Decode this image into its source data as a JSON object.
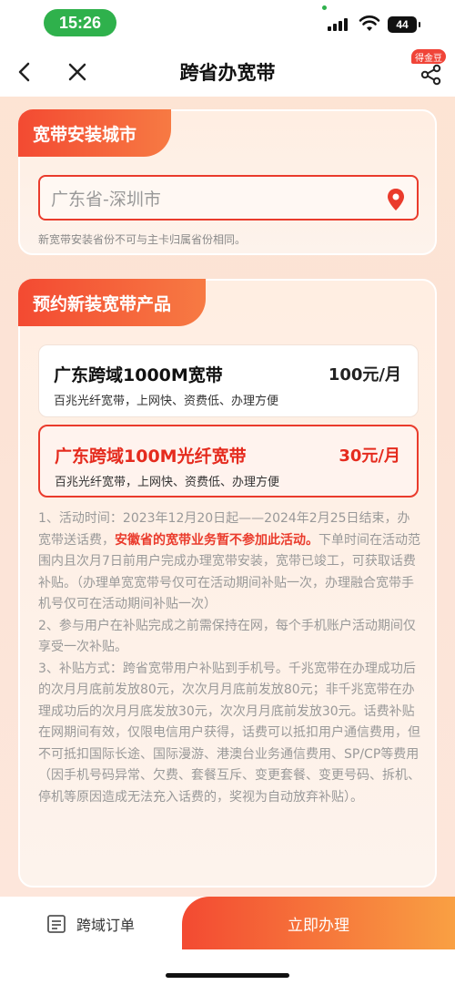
{
  "status_bar": {
    "time": "15:26",
    "battery": "44"
  },
  "nav": {
    "title": "跨省办宽带",
    "coin_badge": "得金豆",
    "icons": {
      "back": "back-arrow-icon",
      "close": "close-icon",
      "share": "share-icon"
    }
  },
  "city_section": {
    "heading": "宽带安装城市",
    "input_value": "广东省-深圳市",
    "note": "新宽带安装省份不可与主卡归属省份相同。",
    "icon": "location-pin-icon"
  },
  "product_section": {
    "heading": "预约新装宽带产品",
    "products": [
      {
        "name": "广东跨域1000M宽带",
        "price": "100元/月",
        "desc": "百兆光纤宽带，上网快、资费低、办理方便",
        "selected": false
      },
      {
        "name": "广东跨域100M光纤宽带",
        "price": "30元/月",
        "desc": "百兆光纤宽带，上网快、资费低、办理方便",
        "selected": true
      }
    ],
    "rules": {
      "p1_before": "1、活动时间：2023年12月20日起——2024年2月25日结束，办宽带送话费，",
      "p1_highlight": "安徽省的宽带业务暂不参加此活动。",
      "p1_after": "下单时间在活动范围内且次月7日前用户完成办理宽带安装，宽带已竣工，可获取话费补贴。（办理单宽宽带号仅可在活动期间补贴一次，办理融合宽带手机号仅可在活动期间补贴一次）",
      "p2": "2、参与用户在补贴完成之前需保持在网，每个手机账户活动期间仅享受一次补贴。",
      "p3": "3、补贴方式：跨省宽带用户补贴到手机号。千兆宽带在办理成功后的次月月底前发放80元，次次月月底前发放80元；非千兆宽带在办理成功后的次月月底发放30元，次次月月底前发放30元。话费补贴在网期间有效，仅限电信用户获得，话费可以抵扣用户通信费用，但不可抵扣国际长途、国际漫游、港澳台业务通信费用、SP/CP等费用（因手机号码异常、欠费、套餐互斥、变更套餐、变更号码、拆机、停机等原因造成无法充入话费的，奖视为自动放弃补贴）。"
    }
  },
  "bottom_bar": {
    "order_label": "跨域订单",
    "order_icon": "order-list-icon",
    "apply_label": "立即办理"
  },
  "colors": {
    "accent": "#ea3b2c",
    "status_green": "#2fb14c"
  }
}
